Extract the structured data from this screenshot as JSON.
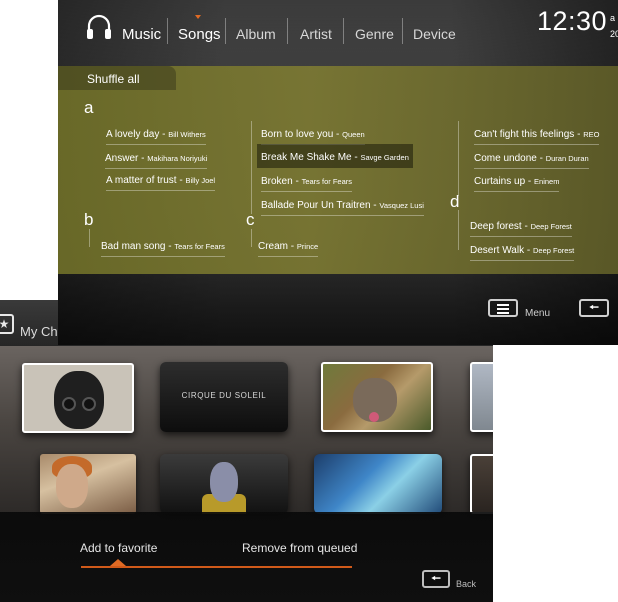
{
  "front": {
    "nav": [
      "Music",
      "Songs",
      "Album",
      "Artist",
      "Genre",
      "Device"
    ],
    "clock": "12:30",
    "clock_side": [
      "a",
      "20"
    ],
    "shuffle_label": "Shuffle all",
    "letters": [
      "a",
      "b",
      "c",
      "d"
    ],
    "songs": [
      {
        "title": "A lovely day",
        "artist": "Bill Withers"
      },
      {
        "title": "Answer",
        "artist": "Makihara Noriyuki"
      },
      {
        "title": "A matter of trust",
        "artist": "Billy Joel"
      },
      {
        "title": "Bad man song",
        "artist": "Tears for Fears"
      },
      {
        "title": "Born to love you",
        "artist": "Queen"
      },
      {
        "title": "Break Me Shake Me",
        "artist": "Savge Garden"
      },
      {
        "title": "Broken",
        "artist": "Tears for Fears"
      },
      {
        "title": "Ballade Pour Un Traitren",
        "artist": "Vasquez Lusi"
      },
      {
        "title": "Cream",
        "artist": "Prince"
      },
      {
        "title": "Can't fight this feelings",
        "artist": "REO"
      },
      {
        "title": "Come undone",
        "artist": "Duran Duran"
      },
      {
        "title": "Curtains up",
        "artist": "Eninem"
      },
      {
        "title": "Deep forest",
        "artist": "Deep Forest"
      },
      {
        "title": "Desert Walk",
        "artist": "Deep Forest"
      }
    ],
    "menu_label": "Menu",
    "icons": {
      "app": "headphones-icon",
      "menu": "menu-icon",
      "back": "back-arrow-icon"
    }
  },
  "back": {
    "title": "My Ch",
    "star_icon": "star-icon",
    "cirque_text": "CIRQUE DU SOLEIL",
    "actions": [
      "Add to favorite",
      "Remove from queued"
    ],
    "back_label": "Back",
    "accent_color": "#e06a24"
  }
}
